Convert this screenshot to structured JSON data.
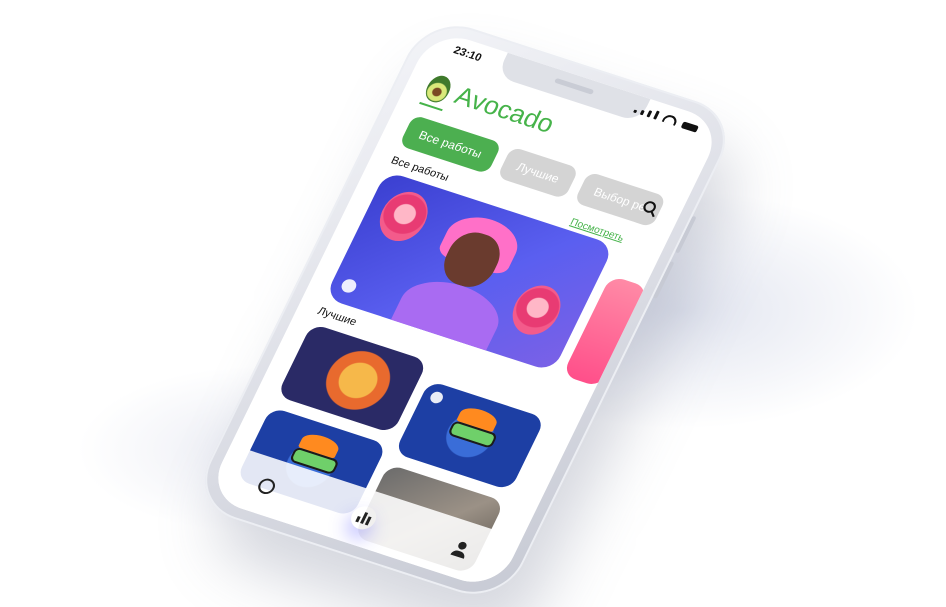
{
  "status_bar": {
    "time": "23:10"
  },
  "app": {
    "name": "Avocado",
    "brand_color": "#46b34a"
  },
  "tabs": [
    {
      "label": "Все работы",
      "active": true
    },
    {
      "label": "Лучшие",
      "active": false
    },
    {
      "label": "Выбор ре",
      "active": false
    }
  ],
  "sections": {
    "all_works_title": "Все работы",
    "see_all_link": "Посмотреть",
    "best_title": "Лучшие"
  },
  "icons": {
    "search": "search-icon",
    "logo": "avocado-logo-icon",
    "nav_explore": "compass-icon",
    "nav_stats": "bar-chart-icon",
    "nav_profile": "user-icon"
  },
  "colors": {
    "active_tab": "#4caf50",
    "inactive_tab": "#d4d4d4",
    "hero_bg": "#3a3fd0",
    "accent_pink": "#ff4f8a",
    "nav_glow": "#6e6cff"
  }
}
